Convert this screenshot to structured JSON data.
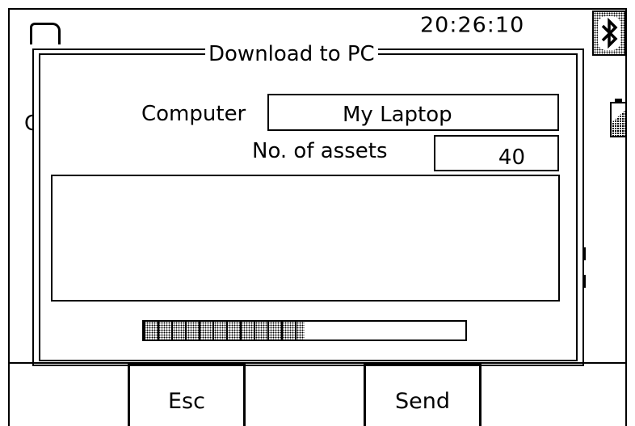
{
  "status_bar": {
    "time": "20:26:10",
    "bluetooth_icon": "bluetooth-icon",
    "battery_icon": "battery-icon",
    "battery_level": 0.6
  },
  "background": {
    "partial_char": "C"
  },
  "dialog": {
    "title": "Download to PC",
    "computer_label": "Computer",
    "computer_value": "My Laptop",
    "assets_label": "No. of assets",
    "assets_value": "40",
    "log_text": "",
    "progress": 0.5
  },
  "softkeys": {
    "esc_label": "Esc",
    "send_label": "Send"
  }
}
